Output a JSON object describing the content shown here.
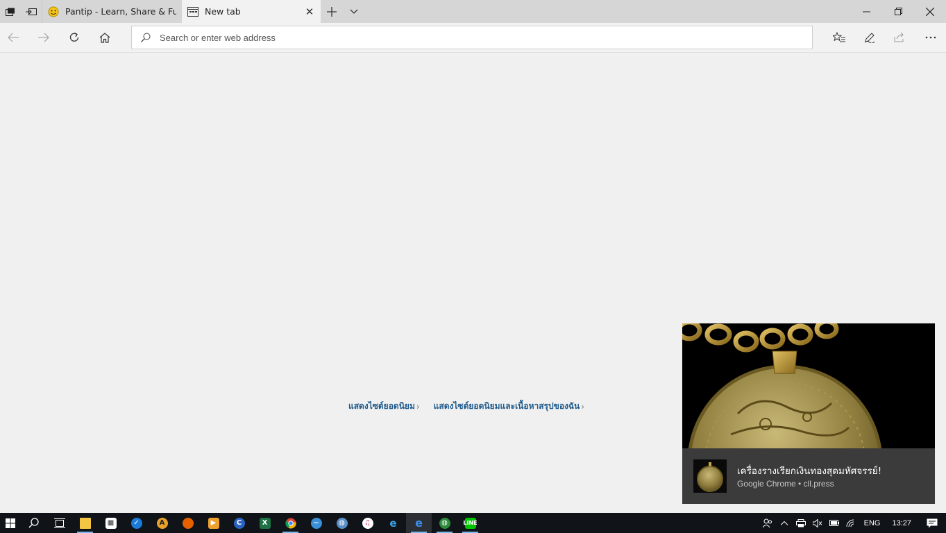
{
  "tabs": [
    {
      "title": "Pantip - Learn, Share & Fun",
      "favicon": "pantip-smiley-icon",
      "active": false
    },
    {
      "title": "New tab",
      "favicon": "newtab-icon",
      "active": true
    }
  ],
  "address_bar": {
    "placeholder": "Search or enter web address",
    "value": ""
  },
  "top_sites_links": [
    {
      "label": "แสดงไซต์ยอดนิยม"
    },
    {
      "label": "แสดงไซต์ยอดนิยมและเนื้อหาสรุปของฉัน"
    }
  ],
  "notification": {
    "title": "เครื่องรางเรียกเงินทองสุดมหัศจรรย์!",
    "source": "Google Chrome • cll.press",
    "image": "gold-coin-pendant-image"
  },
  "taskbar": {
    "apps": [
      "file-explorer-icon",
      "store-icon",
      "app-blue-icon",
      "app-orange-icon",
      "firefox-icon",
      "media-player-icon",
      "app-c-icon",
      "excel-icon",
      "chrome-icon",
      "app-bird-icon",
      "app-globe-icon",
      "itunes-icon",
      "internet-explorer-icon",
      "edge-icon",
      "app-green-globe-icon",
      "line-icon"
    ],
    "language": "ENG",
    "time": "13:27"
  },
  "colors": {
    "accent": "#1e5a8c",
    "taskbar": "#101418",
    "tab_strip": "#d6d6d6",
    "toast_body": "#3b3b3b"
  }
}
